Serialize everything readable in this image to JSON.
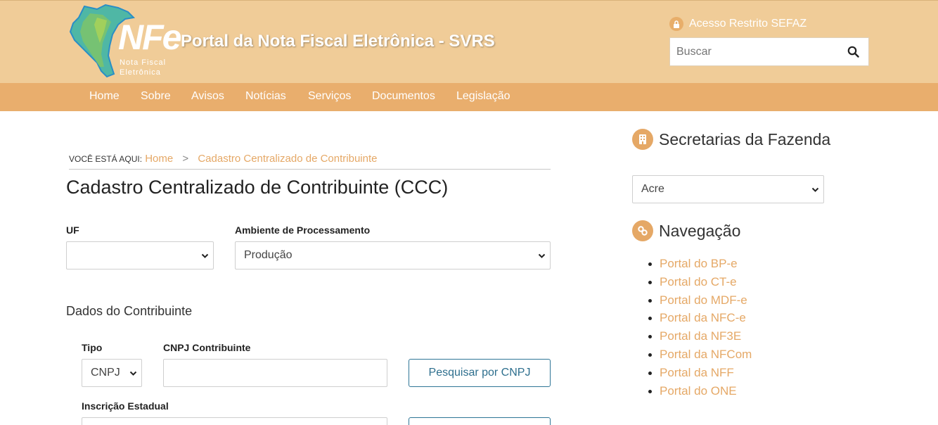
{
  "header": {
    "logo_text": "NFe",
    "logo_subtext_line1": "Nota Fiscal",
    "logo_subtext_line2": "Eletrônica",
    "site_title": "Portal da Nota Fiscal Eletrônica - SVRS",
    "restricted_link": "Acesso Restrito SEFAZ",
    "search_placeholder": "Buscar"
  },
  "nav": {
    "items": [
      "Home",
      "Sobre",
      "Avisos",
      "Notícias",
      "Serviços",
      "Documentos",
      "Legislação"
    ]
  },
  "breadcrumb": {
    "label": "VOCÊ ESTÁ AQUI:",
    "home": "Home",
    "separator": ">",
    "current": "Cadastro Centralizado de Contribuinte"
  },
  "main": {
    "page_title": "Cadastro Centralizado de Contribuinte (CCC)",
    "uf_label": "UF",
    "uf_value": "",
    "ambiente_label": "Ambiente de Processamento",
    "ambiente_value": "Produção",
    "section_heading": "Dados do Contribuinte",
    "tipo_label": "Tipo",
    "tipo_value": "CNPJ",
    "cnpj_label": "CNPJ Contribuinte",
    "cnpj_value": "",
    "search_cnpj_button": "Pesquisar por CNPJ",
    "ie_label": "Inscrição Estadual"
  },
  "sidebar": {
    "secretarias_heading": "Secretarias da Fazenda",
    "secretaria_selected": "Acre",
    "navegacao_heading": "Navegação",
    "links": [
      "Portal do BP-e",
      "Portal do CT-e",
      "Portal do MDF-e",
      "Portal da NFC-e",
      "Portal da NF3E",
      "Portal da NFCom",
      "Portal da NFF",
      "Portal do ONE"
    ]
  },
  "colors": {
    "header_bg": "#f0cc98",
    "nav_bg": "#e9ae6d",
    "accent": "#e5a866",
    "button_border": "#2e7596"
  }
}
